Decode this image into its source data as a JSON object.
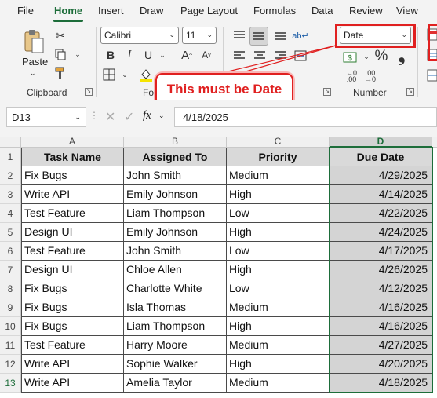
{
  "menu": {
    "tabs": [
      "File",
      "Home",
      "Insert",
      "Draw",
      "Page Layout",
      "Formulas",
      "Data",
      "Review",
      "View"
    ],
    "active": "Home"
  },
  "ribbon": {
    "clipboard": {
      "paste_label": "Paste",
      "group_label": "Clipboard"
    },
    "font": {
      "name": "Calibri",
      "size": "11",
      "group_label_visible": "Fo"
    },
    "number": {
      "format": "Date",
      "percent_symbol": "%",
      "comma_symbol": "❟",
      "group_label": "Number"
    }
  },
  "callout": {
    "text": "This must be Date"
  },
  "formula_bar": {
    "name_box": "D13",
    "fx": "fx",
    "value": "4/18/2025"
  },
  "grid": {
    "columns": [
      "A",
      "B",
      "C",
      "D"
    ],
    "selected_column": "D",
    "selected_cell": "D13",
    "headers": [
      "Task Name",
      "Assigned To",
      "Priority",
      "Due Date"
    ],
    "rows": [
      [
        "Fix Bugs",
        "John Smith",
        "Medium",
        "4/29/2025"
      ],
      [
        "Write API",
        "Emily Johnson",
        "High",
        "4/14/2025"
      ],
      [
        "Test Feature",
        "Liam Thompson",
        "Low",
        "4/22/2025"
      ],
      [
        "Design UI",
        "Emily Johnson",
        "High",
        "4/24/2025"
      ],
      [
        "Test Feature",
        "John Smith",
        "Low",
        "4/17/2025"
      ],
      [
        "Design UI",
        "Chloe Allen",
        "High",
        "4/26/2025"
      ],
      [
        "Fix Bugs",
        "Charlotte White",
        "Low",
        "4/12/2025"
      ],
      [
        "Fix Bugs",
        "Isla Thomas",
        "Medium",
        "4/16/2025"
      ],
      [
        "Fix Bugs",
        "Liam Thompson",
        "High",
        "4/16/2025"
      ],
      [
        "Test Feature",
        "Harry Moore",
        "Medium",
        "4/27/2025"
      ],
      [
        "Write API",
        "Sophie Walker",
        "High",
        "4/20/2025"
      ],
      [
        "Write API",
        "Amelia Taylor",
        "Medium",
        "4/18/2025"
      ]
    ]
  },
  "colors": {
    "accent": "#1d6d3a",
    "highlight": "#e02020",
    "header_fill": "#d9d9d9"
  }
}
